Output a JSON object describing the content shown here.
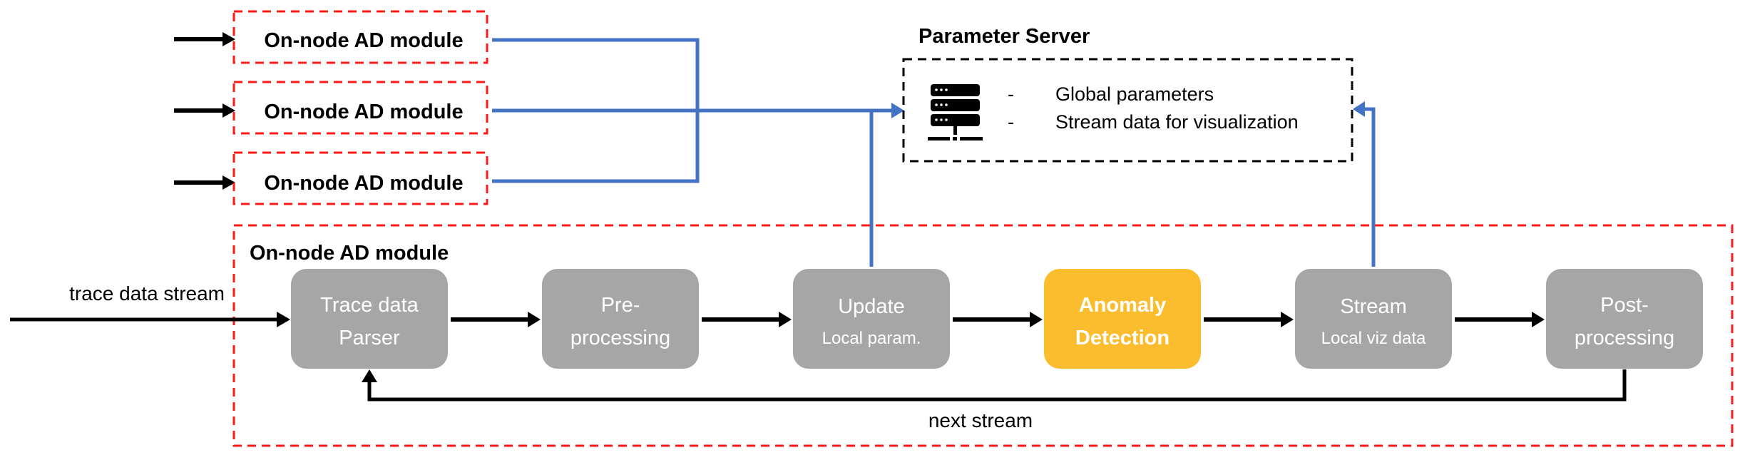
{
  "colors": {
    "module_border": "#ff1a1a",
    "server_border": "#000000",
    "blue_link": "#4472c4",
    "arrow": "#000000",
    "step_gray": "#a6a6a6",
    "step_highlight": "#fbbd2e",
    "step_text": "#ffffff"
  },
  "remote_modules": [
    {
      "label": "On-node AD module"
    },
    {
      "label": "On-node AD module"
    },
    {
      "label": "On-node AD module"
    }
  ],
  "parameter_server": {
    "title": "Parameter Server",
    "icon": "server-icon",
    "bullet": "-",
    "items": [
      "Global parameters",
      "Stream data for visualization"
    ]
  },
  "main_module": {
    "title": "On-node AD module",
    "input_label": "trace data stream",
    "feedback_label": "next stream",
    "steps": [
      {
        "id": "trace-parser",
        "lines": [
          "Trace data",
          "Parser"
        ],
        "highlight": false,
        "sub": false
      },
      {
        "id": "pre-processing",
        "lines": [
          "Pre-",
          "processing"
        ],
        "highlight": false,
        "sub": false
      },
      {
        "id": "update-local-param",
        "lines": [
          "Update",
          "Local param."
        ],
        "highlight": false,
        "sub": true
      },
      {
        "id": "anomaly-detection",
        "lines": [
          "Anomaly",
          "Detection"
        ],
        "highlight": true,
        "sub": false
      },
      {
        "id": "stream-local-viz",
        "lines": [
          "Stream",
          "Local viz data"
        ],
        "highlight": false,
        "sub": true
      },
      {
        "id": "post-processing",
        "lines": [
          "Post-",
          "processing"
        ],
        "highlight": false,
        "sub": false
      }
    ]
  }
}
